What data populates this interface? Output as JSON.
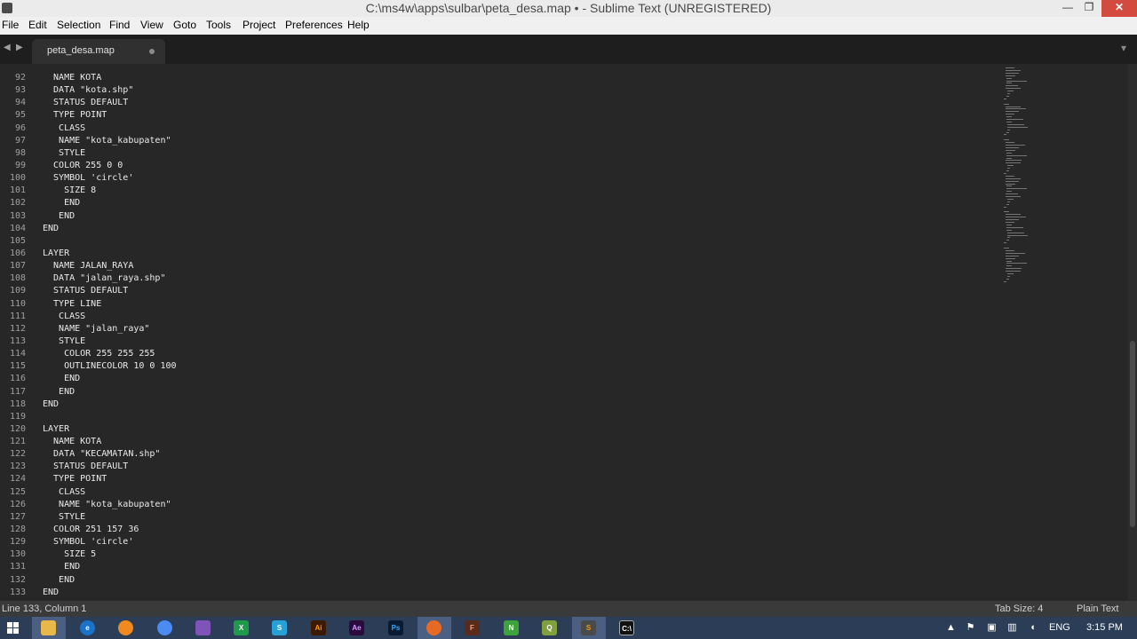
{
  "window": {
    "title": "C:\\ms4w\\apps\\sulbar\\peta_desa.map • - Sublime Text (UNREGISTERED)"
  },
  "menu": [
    "File",
    "Edit",
    "Selection",
    "Find",
    "View",
    "Goto",
    "Tools",
    "Project",
    "Preferences",
    "Help"
  ],
  "tab": {
    "label": "peta_desa.map"
  },
  "editor": {
    "lines": [
      {
        "num": "92",
        "text": "  NAME KOTA"
      },
      {
        "num": "93",
        "text": "  DATA \"kota.shp\""
      },
      {
        "num": "94",
        "text": "  STATUS DEFAULT"
      },
      {
        "num": "95",
        "text": "  TYPE POINT"
      },
      {
        "num": "96",
        "text": "   CLASS"
      },
      {
        "num": "97",
        "text": "   NAME \"kota_kabupaten\""
      },
      {
        "num": "98",
        "text": "   STYLE"
      },
      {
        "num": "99",
        "text": "  COLOR 255 0 0"
      },
      {
        "num": "100",
        "text": "  SYMBOL 'circle'"
      },
      {
        "num": "101",
        "text": "    SIZE 8"
      },
      {
        "num": "102",
        "text": "    END"
      },
      {
        "num": "103",
        "text": "   END"
      },
      {
        "num": "104",
        "text": "END"
      },
      {
        "num": "105",
        "text": ""
      },
      {
        "num": "106",
        "text": "LAYER"
      },
      {
        "num": "107",
        "text": "  NAME JALAN_RAYA"
      },
      {
        "num": "108",
        "text": "  DATA \"jalan_raya.shp\""
      },
      {
        "num": "109",
        "text": "  STATUS DEFAULT"
      },
      {
        "num": "110",
        "text": "  TYPE LINE"
      },
      {
        "num": "111",
        "text": "   CLASS"
      },
      {
        "num": "112",
        "text": "   NAME \"jalan_raya\""
      },
      {
        "num": "113",
        "text": "   STYLE"
      },
      {
        "num": "114",
        "text": "    COLOR 255 255 255"
      },
      {
        "num": "115",
        "text": "    OUTLINECOLOR 10 0 100"
      },
      {
        "num": "116",
        "text": "    END"
      },
      {
        "num": "117",
        "text": "   END"
      },
      {
        "num": "118",
        "text": "END"
      },
      {
        "num": "119",
        "text": ""
      },
      {
        "num": "120",
        "text": "LAYER"
      },
      {
        "num": "121",
        "text": "  NAME KOTA"
      },
      {
        "num": "122",
        "text": "  DATA \"KECAMATAN.shp\""
      },
      {
        "num": "123",
        "text": "  STATUS DEFAULT"
      },
      {
        "num": "124",
        "text": "  TYPE POINT"
      },
      {
        "num": "125",
        "text": "   CLASS"
      },
      {
        "num": "126",
        "text": "   NAME \"kota_kabupaten\""
      },
      {
        "num": "127",
        "text": "   STYLE"
      },
      {
        "num": "128",
        "text": "  COLOR 251 157 36"
      },
      {
        "num": "129",
        "text": "  SYMBOL 'circle'"
      },
      {
        "num": "130",
        "text": "    SIZE 5"
      },
      {
        "num": "131",
        "text": "    END"
      },
      {
        "num": "132",
        "text": "   END"
      },
      {
        "num": "133",
        "text": "END"
      }
    ]
  },
  "status": {
    "position": "Line 133, Column 1",
    "tab_size": "Tab Size: 4",
    "syntax": "Plain Text"
  },
  "taskbar": {
    "language": "ENG",
    "time": "3:15 PM"
  },
  "colors": {
    "editor_bg": "#272727",
    "taskbar_bg": "#2c3d57",
    "close_button": "#d24b3e"
  }
}
